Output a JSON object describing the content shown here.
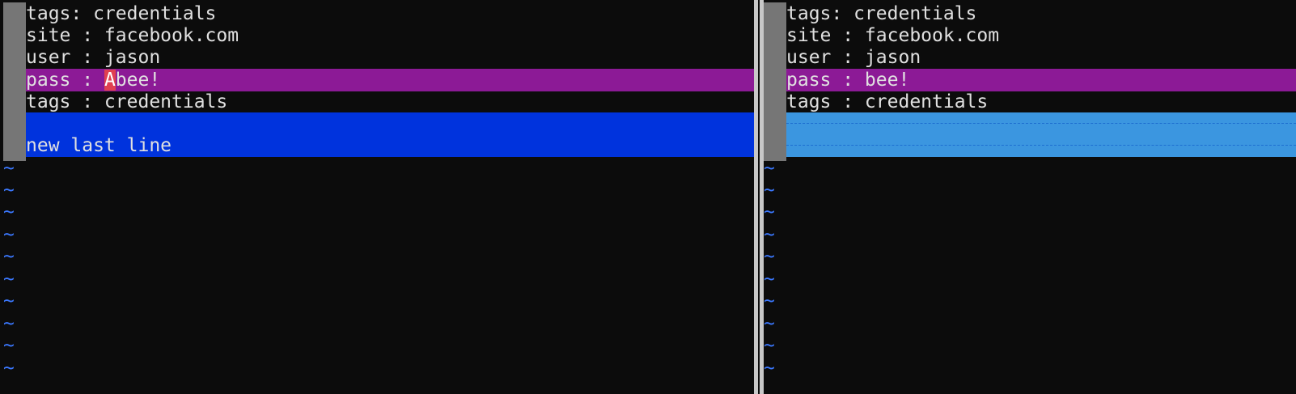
{
  "colors": {
    "background": "#0c0c0c",
    "text": "#e0e0e0",
    "changed_line": "#8c1a96",
    "changed_text": "#e04050",
    "added_line": "#0033dd",
    "filler_line": "#3b96e0",
    "tilde": "#3b78ff",
    "fold_column": "#767676"
  },
  "left_pane": {
    "lines": [
      {
        "text": "tags: credentials",
        "status": "normal"
      },
      {
        "text": "site : facebook.com",
        "status": "normal"
      },
      {
        "text": "user : jason",
        "status": "normal"
      },
      {
        "prefix": "pass : ",
        "diff": "A",
        "suffix": "bee!",
        "status": "changed"
      },
      {
        "text": "tags : credentials",
        "status": "normal"
      },
      {
        "text": "",
        "status": "added"
      },
      {
        "text": "new last line",
        "status": "added"
      }
    ],
    "tilde": "~"
  },
  "right_pane": {
    "lines": [
      {
        "text": "tags: credentials",
        "status": "normal"
      },
      {
        "text": "site : facebook.com",
        "status": "normal"
      },
      {
        "text": "user : jason",
        "status": "normal"
      },
      {
        "text": "pass : bee!",
        "status": "changed"
      },
      {
        "text": "tags : credentials",
        "status": "normal"
      },
      {
        "text": "",
        "status": "filler"
      },
      {
        "text": "",
        "status": "filler"
      }
    ],
    "tilde": "~"
  }
}
